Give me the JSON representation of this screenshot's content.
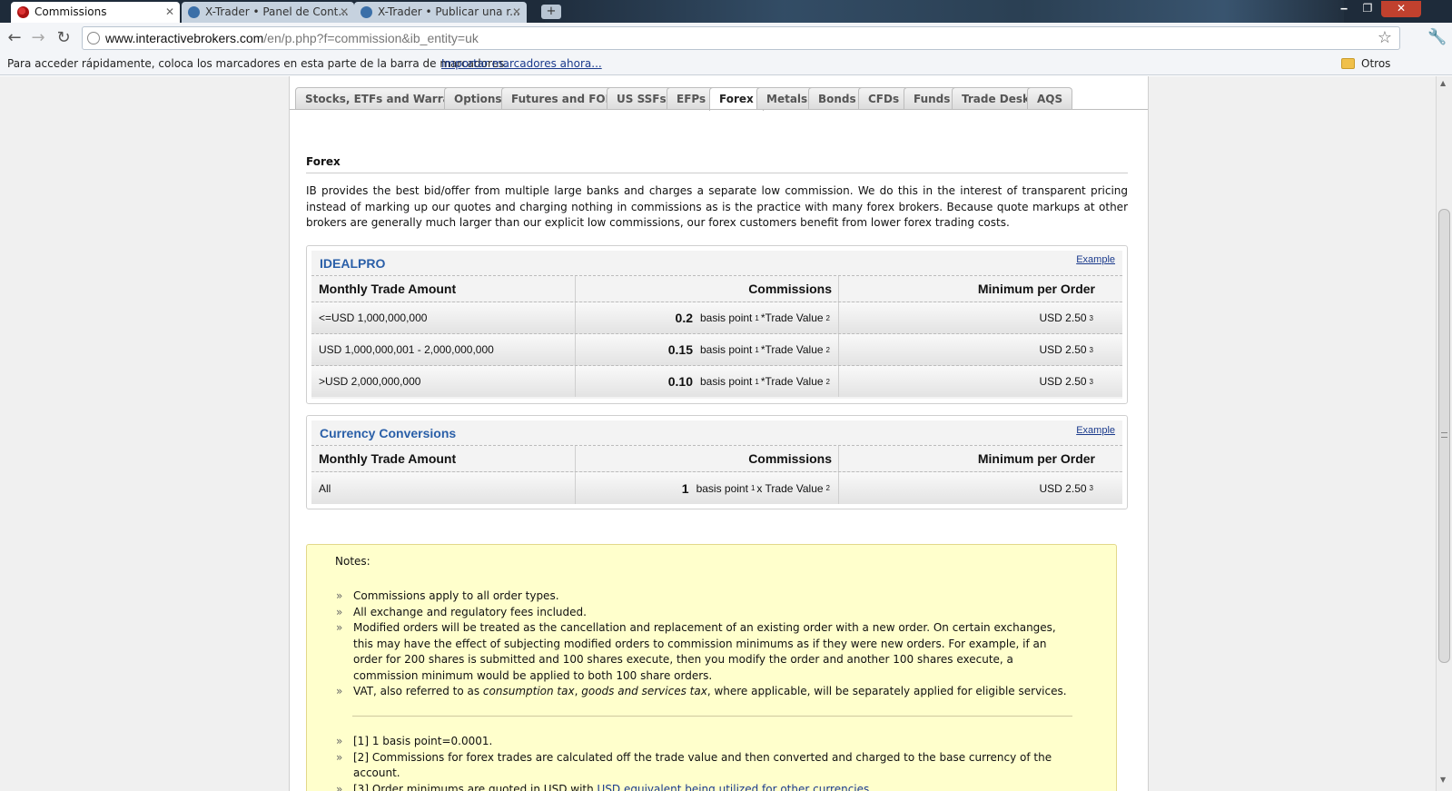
{
  "browser": {
    "tabs": [
      {
        "title": "Commissions",
        "active": true
      },
      {
        "title": "X-Trader • Panel de Cont...",
        "active": false
      },
      {
        "title": "X-Trader • Publicar una r...",
        "active": false
      }
    ],
    "url_host": "www.interactivebrokers.com",
    "url_path": "/en/p.php?f=commission&ib_entity=uk",
    "bookmarks_message": "Para acceder rápidamente, coloca los marcadores en esta parte de la barra de marcadores.",
    "bookmarks_import": "Importar marcadores ahora...",
    "other_bookmarks": "Otros marcadores"
  },
  "product_tabs": [
    "Stocks, ETFs and Warrants",
    "Options",
    "Futures and FOPs",
    "US SSFs",
    "EFPs",
    "Forex",
    "Metals",
    "Bonds",
    "CFDs",
    "Funds",
    "Trade Desk",
    "AQS"
  ],
  "selected_tab": "Forex",
  "section": {
    "title": "Forex",
    "intro": "IB provides the best bid/offer from multiple large banks and charges a separate low commission. We do this in the interest of transparent pricing instead of marking up our quotes and charging nothing in commissions as is the practice with many forex brokers. Because quote markups at other brokers are generally much larger than our explicit low commissions, our forex customers benefit from lower forex trading costs."
  },
  "idealpro": {
    "title": "IDEALPRO",
    "example": "Example",
    "headers": [
      "Monthly Trade Amount",
      "Commissions",
      "Minimum per Order"
    ],
    "rows": [
      {
        "amount": "<=USD 1,000,000,000",
        "rate": "0.2",
        "unit": "basis point",
        "sup1": "1",
        "mult": "*Trade Value",
        "sup2": "2",
        "min": "USD 2.50",
        "sup3": "3"
      },
      {
        "amount": "USD 1,000,000,001 - 2,000,000,000",
        "rate": "0.15",
        "unit": "basis point",
        "sup1": "1",
        "mult": "*Trade Value",
        "sup2": "2",
        "min": "USD 2.50",
        "sup3": "3"
      },
      {
        "amount": ">USD 2,000,000,000",
        "rate": "0.10",
        "unit": "basis point",
        "sup1": "1",
        "mult": "*Trade Value",
        "sup2": "2",
        "min": "USD 2.50",
        "sup3": "3"
      }
    ]
  },
  "conversions": {
    "title": "Currency Conversions",
    "example": "Example",
    "headers": [
      "Monthly Trade Amount",
      "Commissions",
      "Minimum per Order"
    ],
    "rows": [
      {
        "amount": "All",
        "rate": "1",
        "unit": "basis point",
        "sup1": "1",
        "mult": "x Trade Value",
        "sup2": "2",
        "min": "USD 2.50",
        "sup3": "3"
      }
    ]
  },
  "notes": {
    "title": "Notes:",
    "bullet": "»",
    "items": [
      "Commissions apply to all order types.",
      "All exchange and regulatory fees included.",
      "Modified orders will be treated as the cancellation and replacement of an existing order with a new order. On certain exchanges, this may have the effect of subjecting modified orders to commission minimums as if they were new orders. For example, if an order for 200 shares is submitted and 100 shares execute, then you modify the order and another 100 shares execute, a commission minimum would be applied to both 100 share orders."
    ],
    "vat": {
      "pre": "VAT, also referred to as ",
      "em1": "consumption tax",
      "sep": ", ",
      "em2": "goods and services tax",
      "post": ", where applicable, will be separately applied for eligible services."
    },
    "footnotes": [
      "[1] 1 basis point=0.0001.",
      "[2] Commissions for forex trades are calculated off the trade value and then converted and charged to the base currency of the account."
    ],
    "footnote3_pre": "[3] Order minimums are quoted in USD with ",
    "footnote3_link": "USD equivalent being utilized for other currencies",
    "footnote3_post": "."
  },
  "icons": {
    "back": "back-arrow-icon",
    "forward": "forward-arrow-icon",
    "reload": "reload-icon",
    "star": "star-icon",
    "wrench": "wrench-icon",
    "folder": "folder-icon"
  }
}
